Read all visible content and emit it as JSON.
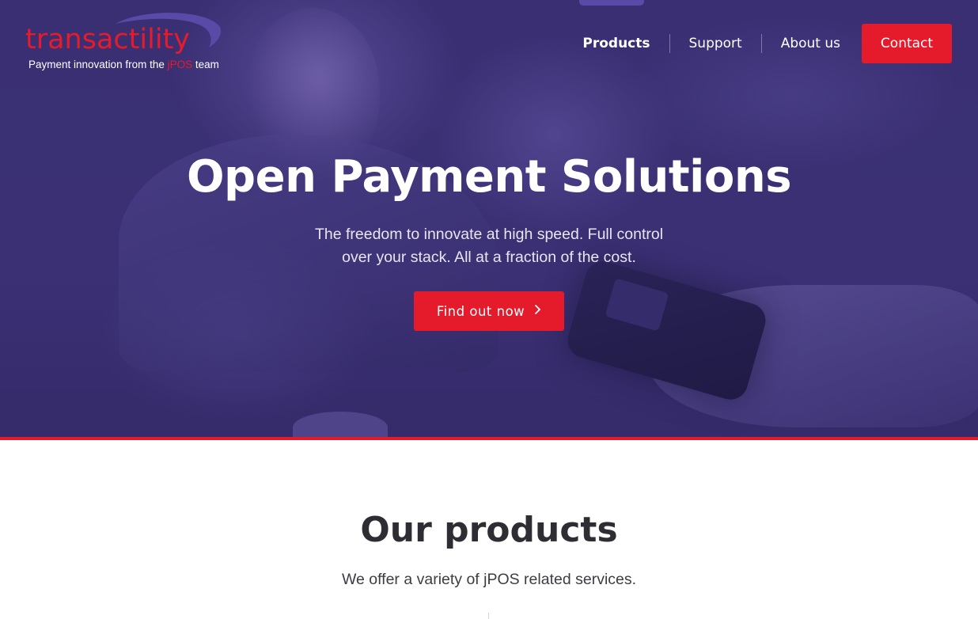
{
  "header": {
    "logo": {
      "wordmark": "transactility",
      "tagline_prefix": "Payment innovation from the ",
      "tagline_accent": "jPOS",
      "tagline_suffix": " team"
    },
    "nav": {
      "items": [
        {
          "label": "Products",
          "active": true
        },
        {
          "label": "Support",
          "active": false
        },
        {
          "label": "About us",
          "active": false
        }
      ],
      "contact_label": "Contact"
    }
  },
  "hero": {
    "title": "Open Payment Solutions",
    "subtitle_line1": "The freedom to innovate at high speed. Full control",
    "subtitle_line2": "over your stack. All at a fraction of the cost.",
    "cta_label": "Find out now",
    "cta_icon": "chevron-right-icon"
  },
  "products": {
    "title": "Our products",
    "subtitle": "We offer a variety of jPOS related services."
  },
  "colors": {
    "brand_red": "#e51b2b",
    "hero_overlay": "#3a2f73",
    "accent_purple": "#5a4aa8",
    "heading_dark": "#2e2d33"
  }
}
